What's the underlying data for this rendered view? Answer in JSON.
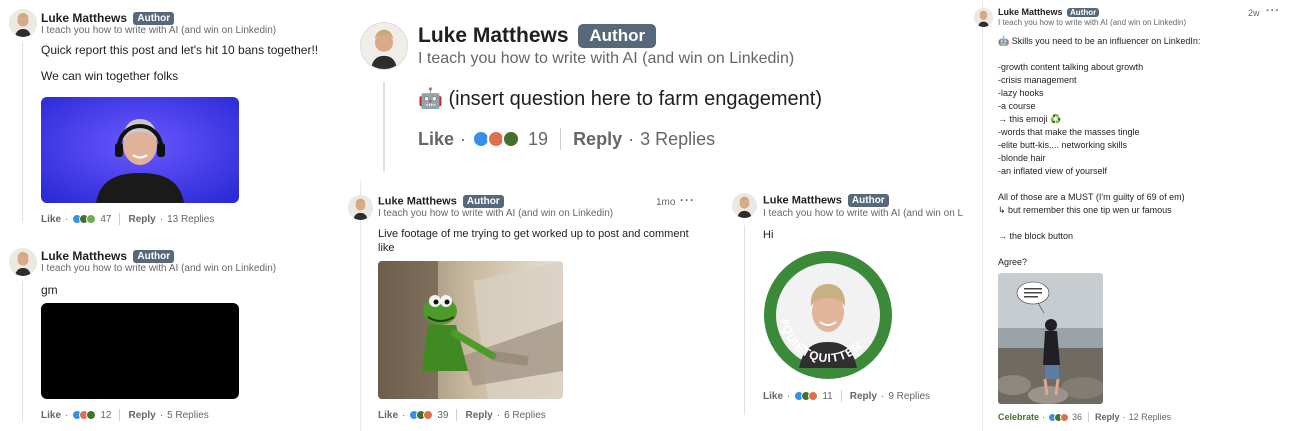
{
  "author": {
    "name": "Luke Matthews",
    "badge": "Author",
    "tagline": "I teach you how to write with AI (and win on Linkedin)"
  },
  "colors": {
    "badge_bg": "#56687a",
    "like": "#378fe9",
    "celebrate": "#44712e",
    "support": "#6dae4f",
    "love": "#df704d"
  },
  "actions": {
    "like": "Like",
    "reply": "Reply",
    "celebrate": "Celebrate"
  },
  "comments": {
    "c1": {
      "text": "Quick report this post and let's hit 10 bans together!!\n\nWe can win together folks",
      "image": "man-with-headphones-photo",
      "reactions": "47",
      "replies": "13 Replies"
    },
    "c2": {
      "text": "gm",
      "image": "black-image",
      "reactions": "12",
      "replies": "5 Replies"
    },
    "c3": {
      "text": "🤖 (insert question here to farm engagement)",
      "reactions": "19",
      "replies": "3 Replies"
    },
    "c4": {
      "text": "Live footage of me trying to get worked up to post and comment like",
      "time": "1mo",
      "image": "kermit-typing-gif",
      "reactions": "39",
      "replies": "6 Replies"
    },
    "c5": {
      "text": "Hi",
      "image": "quietquitter-profile-photo",
      "badge_text": "#QUIETQUITTER",
      "reactions": "11",
      "replies": "9 Replies"
    },
    "c6": {
      "time": "2w",
      "lines": [
        "🤖 Skills you need to be an influencer on LinkedIn:",
        "",
        "-growth content talking about growth",
        "-crisis management",
        "-lazy hooks",
        "-a course",
        "→ this emoji ♻️",
        "-words that make the masses tingle",
        "-elite butt-kis.... networking skills",
        "-blonde hair",
        "-an inflated view of yourself",
        "",
        "All of those are a MUST (I'm guilty of 69 of em)",
        "↳ but remember this one tip wen ur famous",
        "",
        "→ the block button",
        "",
        "Agree?"
      ],
      "image": "man-on-rocky-beach-photo",
      "reactions": "36",
      "replies": "12 Replies"
    }
  }
}
